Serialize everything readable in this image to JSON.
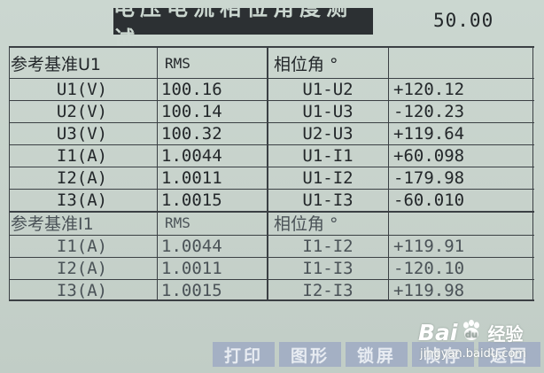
{
  "header": {
    "title": "电压电流相位角度测试",
    "frequency": "50.00"
  },
  "table_u1": {
    "headers": [
      "参考基准U1",
      "RMS",
      "相位角 °",
      ""
    ],
    "rows": [
      [
        "U1(V)",
        "100.16",
        "U1-U2",
        "+120.12"
      ],
      [
        "U2(V)",
        "100.14",
        "U1-U3",
        "-120.23"
      ],
      [
        "U3(V)",
        "100.32",
        "U2-U3",
        "+119.64"
      ],
      [
        "I1(A)",
        "1.0044",
        "U1-I1",
        "+60.098"
      ],
      [
        "I2(A)",
        "1.0011",
        "U1-I2",
        "-179.98"
      ],
      [
        "I3(A)",
        "1.0015",
        "U1-I3",
        "-60.010"
      ]
    ]
  },
  "table_i1": {
    "headers": [
      "参考基准I1",
      "RMS",
      "相位角 °",
      ""
    ],
    "rows": [
      [
        "I1(A)",
        "1.0044",
        "I1-I2",
        "+119.91"
      ],
      [
        "I2(A)",
        "1.0011",
        "I1-I3",
        "-120.10"
      ],
      [
        "I3(A)",
        "1.0015",
        "I2-I3",
        "+119.98"
      ]
    ]
  },
  "softkeys": [
    {
      "label": "打印"
    },
    {
      "label": "图形"
    },
    {
      "label": "锁屏"
    },
    {
      "label": "帧存"
    },
    {
      "label": "返回"
    }
  ],
  "watermark": {
    "brand": "Bai",
    "paw_icon": "baidu-paw-icon",
    "jingyan": "经验",
    "url": "jingyan.baidu.com"
  }
}
